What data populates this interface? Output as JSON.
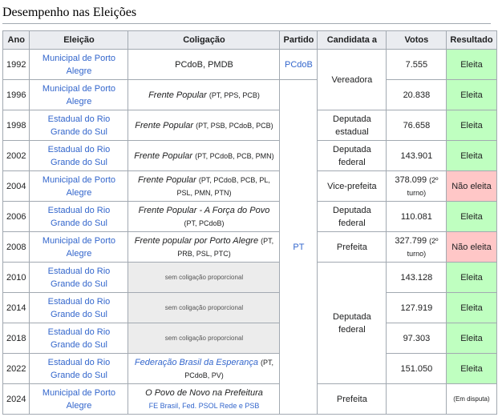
{
  "heading": "Desempenho nas Eleições",
  "headers": {
    "year": "Ano",
    "election": "Eleição",
    "coalition": "Coligação",
    "party": "Partido",
    "candidate": "Candidata a",
    "votes": "Votos",
    "result": "Resultado"
  },
  "rows": [
    {
      "year": "1992",
      "election": "Municipal de Porto Alegre",
      "coalition_name": "PCdoB, PMDB",
      "coalition_parties": "",
      "party": "PCdoB",
      "candidate": "Vereadora",
      "votes": "7.555",
      "votes_note": "",
      "result": "Eleita"
    },
    {
      "year": "1996",
      "election": "Municipal de Porto Alegre",
      "coalition_name": "Frente Popular",
      "coalition_parties": "(PT, PPS, PCB)",
      "votes": "20.838",
      "votes_note": "",
      "result": "Eleita"
    },
    {
      "year": "1998",
      "election": "Estadual do Rio Grande do Sul",
      "coalition_name": "Frente Popular",
      "coalition_parties": "(PT, PSB, PCdoB, PCB)",
      "candidate": "Deputada estadual",
      "votes": "76.658",
      "votes_note": "",
      "result": "Eleita"
    },
    {
      "year": "2002",
      "election": "Estadual do Rio Grande do Sul",
      "coalition_name": "Frente Popular",
      "coalition_parties": "(PT, PCdoB, PCB, PMN)",
      "candidate": "Deputada federal",
      "votes": "143.901",
      "votes_note": "",
      "result": "Eleita"
    },
    {
      "year": "2004",
      "election": "Municipal de Porto Alegre",
      "coalition_name": "Frente Popular",
      "coalition_parties": "(PT, PCdoB, PCB, PL, PSL, PMN, PTN)",
      "candidate": "Vice-prefeita",
      "votes": "378.099",
      "votes_note": "(2º turno)",
      "result": "Não eleita"
    },
    {
      "year": "2006",
      "election": "Estadual do Rio Grande do Sul",
      "coalition_name": "Frente Popular - A Força do Povo",
      "coalition_parties": "(PT, PCdoB)",
      "candidate": "Deputada federal",
      "votes": "110.081",
      "votes_note": "",
      "result": "Eleita"
    },
    {
      "year": "2008",
      "election": "Municipal de Porto Alegre",
      "coalition_name": "Frente popular por Porto Alegre",
      "coalition_parties": "(PT, PRB, PSL, PTC)",
      "candidate": "Prefeita",
      "votes": "327.799",
      "votes_note": "(2º turno)",
      "result": "Não eleita"
    },
    {
      "year": "2010",
      "election": "Estadual do Rio Grande do Sul",
      "coalition_name": "sem coligação proporcional",
      "votes": "143.128",
      "result": "Eleita"
    },
    {
      "year": "2014",
      "election": "Estadual do Rio Grande do Sul",
      "coalition_name": "sem coligação proporcional",
      "votes": "127.919",
      "result": "Eleita"
    },
    {
      "year": "2018",
      "election": "Estadual do Rio Grande do Sul",
      "coalition_name": "sem coligação proporcional",
      "votes": "97.303",
      "result": "Eleita"
    },
    {
      "year": "2022",
      "election": "Estadual do Rio Grande do Sul",
      "coalition_name": "Federação Brasil da Esperança",
      "coalition_parties": "(PT, PCdoB, PV)",
      "votes": "151.050",
      "result": "Eleita"
    },
    {
      "year": "2024",
      "election": "Municipal de Porto Alegre",
      "coalition_name": "O Povo de Novo na Prefeitura",
      "coalition_parties": "FE Brasil, Fed. PSOL Rede e PSB",
      "candidate": "Prefeita",
      "votes": "",
      "result": "(Em disputa)"
    }
  ],
  "merged": {
    "party_pt": "PT",
    "candidate_vereadora": "Vereadora",
    "candidate_deputada_federal": "Deputada federal"
  },
  "colors": {
    "link": "#3366cc",
    "won": "#bfffc0",
    "lost": "#ffc7c7",
    "header": "#eaecf0",
    "border": "#a2a9b1"
  }
}
